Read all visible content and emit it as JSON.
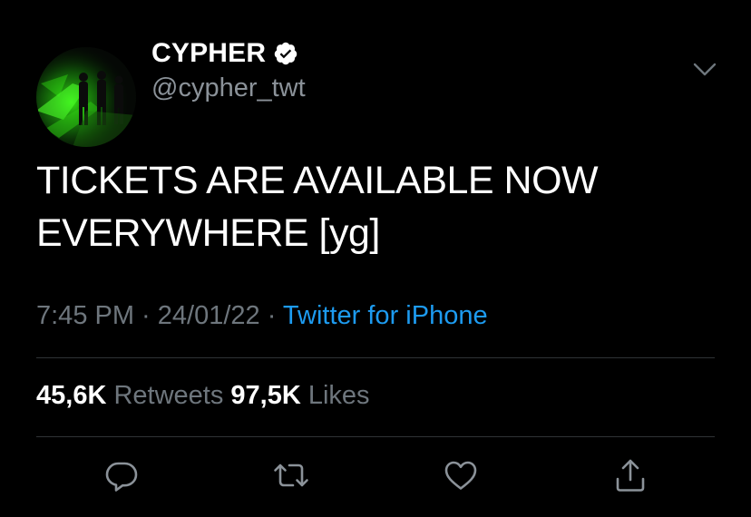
{
  "account": {
    "display_name": "CYPHER",
    "handle": "@cypher_twt",
    "verified": true
  },
  "tweet": {
    "text_line1": "TICKETS ARE AVAILABLE NOW",
    "text_line2": "EVERYWHERE [yg]",
    "time": "7:45 PM",
    "separator": " · ",
    "date": "24/01/22",
    "source": "Twitter for iPhone"
  },
  "stats": {
    "retweets_count": "45,6K",
    "retweets_label": "Retweets",
    "likes_count": "97,5K",
    "likes_label": "Likes"
  },
  "colors": {
    "background": "#000000",
    "text": "#ffffff",
    "secondary": "#6e767d",
    "link": "#1d9bf0",
    "avatar_accent": "#39ff14"
  },
  "icons": {
    "verified": "verified-badge-icon",
    "more": "chevron-down-icon",
    "reply": "reply-icon",
    "retweet": "retweet-icon",
    "like": "heart-icon",
    "share": "share-icon"
  }
}
